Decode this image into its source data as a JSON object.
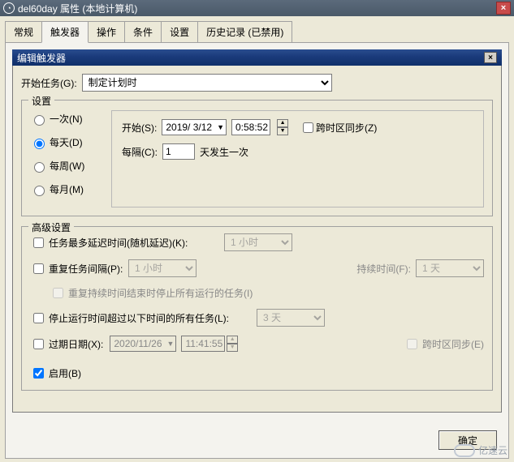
{
  "window": {
    "title": "del60day 属性 (本地计算机)",
    "close_tooltip": "关闭"
  },
  "tabs": [
    "常规",
    "触发器",
    "操作",
    "条件",
    "设置",
    "历史记录 (已禁用)"
  ],
  "active_tab_index": 1,
  "dialog": {
    "title": "编辑触发器",
    "begin_task_label": "开始任务(G):",
    "begin_task_value": "制定计划时",
    "settings_legend": "设置",
    "frequency": {
      "once": "一次(N)",
      "daily": "每天(D)",
      "weekly": "每周(W)",
      "monthly": "每月(M)",
      "selected": "daily"
    },
    "start_label": "开始(S):",
    "start_date": "2019/ 3/12",
    "start_time": "0:58:52",
    "cross_tz_sync": "跨时区同步(Z)",
    "recur_label_pre": "每隔(C):",
    "recur_value": "1",
    "recur_label_post": "天发生一次",
    "advanced_legend": "高级设置",
    "adv": {
      "delay_label": "任务最多延迟时间(随机延迟)(K):",
      "delay_value": "1 小时",
      "repeat_label": "重复任务间隔(P):",
      "repeat_value": "1 小时",
      "duration_label": "持续时间(F):",
      "duration_value": "1 天",
      "stop_at_end_label": "重复持续时间结束时停止所有运行的任务(I)",
      "stop_exceed_label": "停止运行时间超过以下时间的所有任务(L):",
      "stop_exceed_value": "3 天",
      "expire_label": "过期日期(X):",
      "expire_date": "2020/11/26",
      "expire_time": "11:41:55",
      "expire_tz": "跨时区同步(E)",
      "enabled_label": "启用(B)"
    },
    "ok_button": "确定"
  },
  "watermark": "亿速云"
}
